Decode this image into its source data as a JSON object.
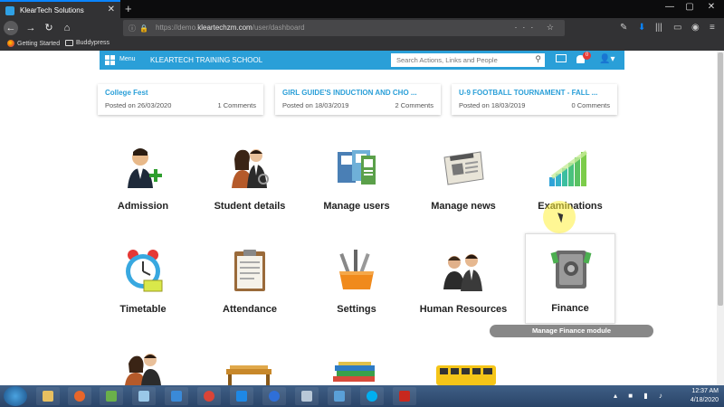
{
  "browser": {
    "tab_title": "KlearTech Solutions",
    "tab_close": "✕",
    "new_tab": "+",
    "url_prefix": "https://demo.",
    "url_host": "kleartechzm.com",
    "url_path": "/user/dashboard",
    "bookmarks": [
      "Getting Started",
      "Buddypress"
    ]
  },
  "header": {
    "menu_label": "Menu",
    "school_name": "KLEARTECH TRAINING SCHOOL",
    "search_placeholder": "Search Actions, Links and People",
    "notification_count": "0"
  },
  "posts": [
    {
      "title": "College Fest",
      "date": "Posted on 26/03/2020",
      "comments": "1 Comments"
    },
    {
      "title": "GIRL GUIDE'S INDUCTION AND CHO ...",
      "date": "Posted on 18/03/2019",
      "comments": "2 Comments"
    },
    {
      "title": "U-9 FOOTBALL TOURNAMENT - FALL ...",
      "date": "Posted on 18/03/2019",
      "comments": "0 Comments"
    }
  ],
  "modules": [
    {
      "label": "Admission",
      "icon": "admission-icon"
    },
    {
      "label": "Student details",
      "icon": "student-details-icon"
    },
    {
      "label": "Manage users",
      "icon": "manage-users-icon"
    },
    {
      "label": "Manage news",
      "icon": "manage-news-icon"
    },
    {
      "label": "Examinations",
      "icon": "examinations-icon"
    },
    {
      "label": "Timetable",
      "icon": "timetable-icon"
    },
    {
      "label": "Attendance",
      "icon": "attendance-icon"
    },
    {
      "label": "Settings",
      "icon": "settings-icon"
    },
    {
      "label": "Human Resources",
      "icon": "human-resources-icon"
    },
    {
      "label": "Finance",
      "icon": "finance-icon"
    }
  ],
  "tooltip": "Manage Finance module",
  "taskbar": {
    "time": "12:37 AM",
    "date": "4/18/2020"
  },
  "colors": {
    "brand": "#2a9fd8",
    "badge": "#e53935"
  }
}
